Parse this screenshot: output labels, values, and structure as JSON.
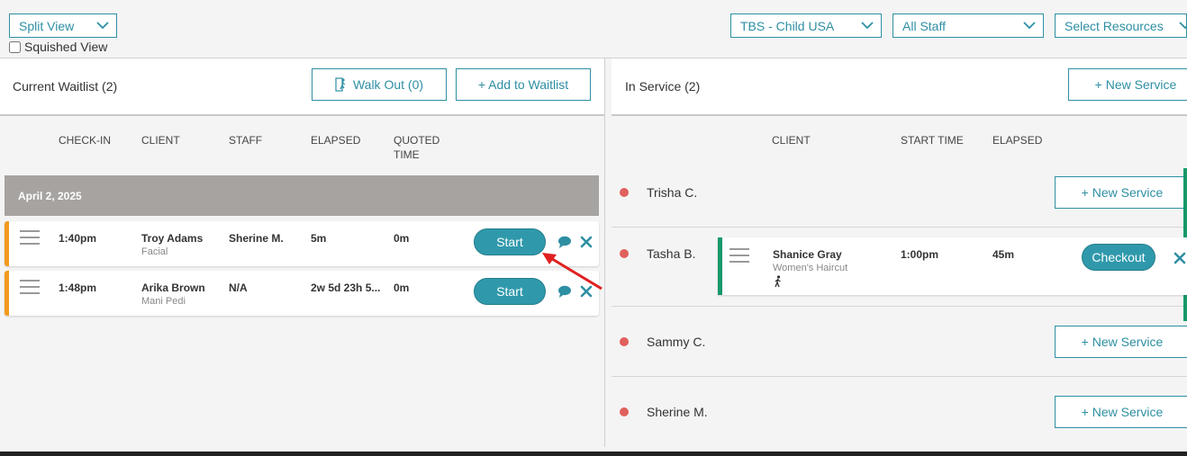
{
  "toolbar": {
    "view_select": "Split View",
    "squished_label": "Squished View",
    "location_select": "TBS - Child USA",
    "staff_select": "All Staff",
    "resources_select": "Select Resources"
  },
  "waitlist": {
    "title": "Current Waitlist (2)",
    "walkout_label": "Walk Out (0)",
    "add_label": "+ Add to Waitlist",
    "columns": {
      "checkin": "CHECK-IN",
      "client": "CLIENT",
      "staff": "STAFF",
      "elapsed": "ELAPSED",
      "quoted_1": "QUOTED",
      "quoted_2": "TIME"
    },
    "date": "April 2, 2025",
    "rows": [
      {
        "checkin": "1:40pm",
        "client": "Troy Adams",
        "service": "Facial",
        "staff": "Sherine M.",
        "elapsed": "5m",
        "quoted": "0m",
        "action": "Start"
      },
      {
        "checkin": "1:48pm",
        "client": "Arika Brown",
        "service": "Mani Pedi",
        "staff": "N/A",
        "elapsed": "2w 5d 23h 5...",
        "quoted": "0m",
        "action": "Start"
      }
    ]
  },
  "in_service": {
    "title": "In Service (2)",
    "new_service_label": "+ New Service",
    "columns": {
      "client": "CLIENT",
      "start_time": "START TIME",
      "elapsed": "ELAPSED"
    },
    "staff": [
      {
        "name": "Trisha C.",
        "action": "+ New Service"
      },
      {
        "name": "Tasha B."
      },
      {
        "name": "Sammy C.",
        "action": "+ New Service"
      },
      {
        "name": "Sherine M.",
        "action": "+ New Service"
      }
    ],
    "active": {
      "client": "Shanice Gray",
      "service": "Women's Haircut",
      "start_time": "1:00pm",
      "elapsed": "45m",
      "action": "Checkout"
    }
  },
  "colors": {
    "accent": "#2e8fa3",
    "waitlist_stripe": "#f39a1e",
    "service_stripe": "#17996a",
    "status_dot": "#e0605c",
    "arrow": "#e02020"
  }
}
